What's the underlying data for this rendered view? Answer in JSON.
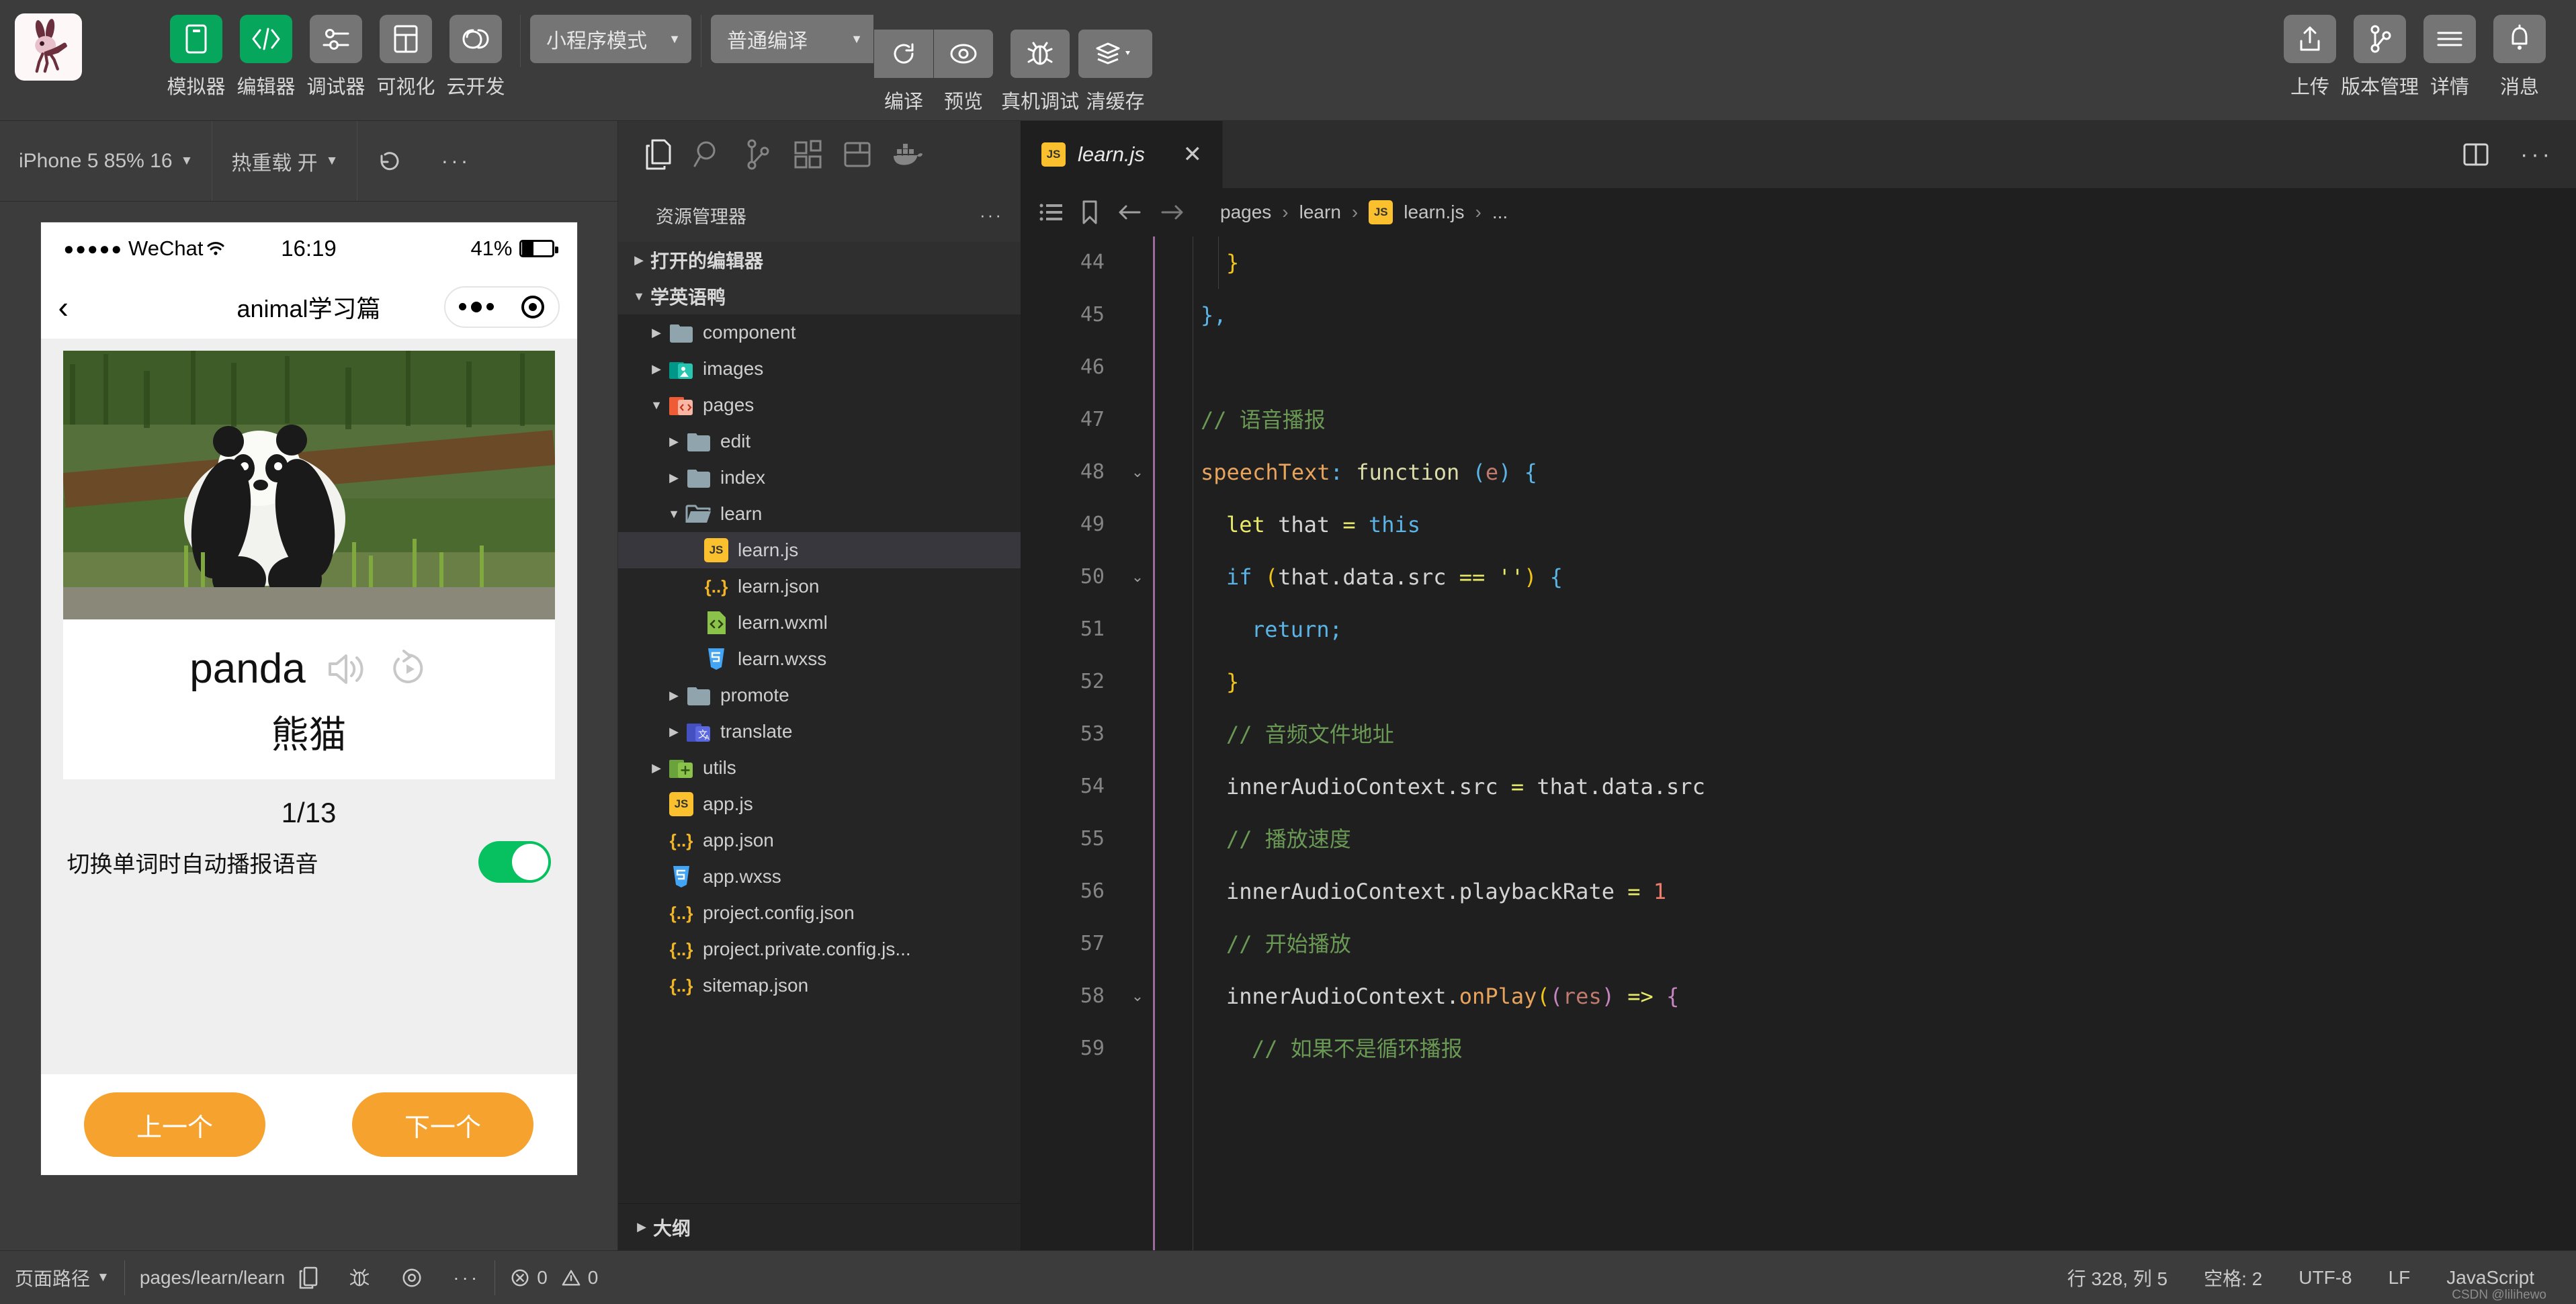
{
  "toolbar": {
    "items": [
      {
        "label": "模拟器",
        "icon": "simulator-icon",
        "active": true
      },
      {
        "label": "编辑器",
        "icon": "code-icon",
        "active": true
      },
      {
        "label": "调试器",
        "icon": "debugger-icon",
        "active": false
      },
      {
        "label": "可视化",
        "icon": "visualize-icon",
        "active": false
      },
      {
        "label": "云开发",
        "icon": "cloud-icon",
        "active": false
      }
    ],
    "mode_select": "小程序模式",
    "compile_select": "普通编译",
    "compile_label": "编译",
    "preview_label": "预览",
    "realdevice_label": "真机调试",
    "clearcache_label": "清缓存",
    "upload_label": "上传",
    "version_label": "版本管理",
    "detail_label": "详情",
    "message_label": "消息"
  },
  "simulator": {
    "device": "iPhone 5 85% 16",
    "hotreload": "热重载 开",
    "phone": {
      "carrier": "WeChat",
      "time": "16:19",
      "battery": "41%",
      "nav_title": "animal学习篇",
      "word": "panda",
      "translation": "熊猫",
      "counter": "1/13",
      "autoplay_label": "切换单词时自动播报语音",
      "prev_button": "上一个",
      "next_button": "下一个"
    }
  },
  "explorer": {
    "title": "资源管理器",
    "more": "···",
    "outline": "大纲",
    "tree": [
      {
        "label": "打开的编辑器",
        "type": "section",
        "indent": 0,
        "arrow": "right"
      },
      {
        "label": "学英语鸭",
        "type": "section",
        "indent": 0,
        "arrow": "down"
      },
      {
        "label": "component",
        "type": "folder",
        "indent": 1,
        "arrow": "right",
        "icon": "folder-plain"
      },
      {
        "label": "images",
        "type": "folder",
        "indent": 1,
        "arrow": "right",
        "icon": "folder-images"
      },
      {
        "label": "pages",
        "type": "folder",
        "indent": 1,
        "arrow": "down",
        "icon": "folder-pages"
      },
      {
        "label": "edit",
        "type": "folder",
        "indent": 2,
        "arrow": "right",
        "icon": "folder-plain"
      },
      {
        "label": "index",
        "type": "folder",
        "indent": 2,
        "arrow": "right",
        "icon": "folder-plain"
      },
      {
        "label": "learn",
        "type": "folder",
        "indent": 2,
        "arrow": "down",
        "icon": "folder-open"
      },
      {
        "label": "learn.js",
        "type": "file",
        "indent": 3,
        "arrow": "none",
        "icon": "js",
        "selected": true
      },
      {
        "label": "learn.json",
        "type": "file",
        "indent": 3,
        "arrow": "none",
        "icon": "json"
      },
      {
        "label": "learn.wxml",
        "type": "file",
        "indent": 3,
        "arrow": "none",
        "icon": "wxml"
      },
      {
        "label": "learn.wxss",
        "type": "file",
        "indent": 3,
        "arrow": "none",
        "icon": "wxss"
      },
      {
        "label": "promote",
        "type": "folder",
        "indent": 2,
        "arrow": "right",
        "icon": "folder-plain"
      },
      {
        "label": "translate",
        "type": "folder",
        "indent": 2,
        "arrow": "right",
        "icon": "folder-translate"
      },
      {
        "label": "utils",
        "type": "folder",
        "indent": 1,
        "arrow": "right",
        "icon": "folder-utils"
      },
      {
        "label": "app.js",
        "type": "file",
        "indent": 1,
        "arrow": "none",
        "icon": "js"
      },
      {
        "label": "app.json",
        "type": "file",
        "indent": 1,
        "arrow": "none",
        "icon": "json"
      },
      {
        "label": "app.wxss",
        "type": "file",
        "indent": 1,
        "arrow": "none",
        "icon": "wxss"
      },
      {
        "label": "project.config.json",
        "type": "file",
        "indent": 1,
        "arrow": "none",
        "icon": "json"
      },
      {
        "label": "project.private.config.js...",
        "type": "file",
        "indent": 1,
        "arrow": "none",
        "icon": "json"
      },
      {
        "label": "sitemap.json",
        "type": "file",
        "indent": 1,
        "arrow": "none",
        "icon": "json"
      }
    ]
  },
  "editor": {
    "tab_name": "learn.js",
    "tab_close": "✕",
    "breadcrumb": [
      "pages",
      "learn",
      "learn.js",
      "..."
    ],
    "lines": [
      {
        "no": "44",
        "fold": "",
        "indent": 2,
        "tokens": [
          {
            "t": "}",
            "c": "tok-par"
          }
        ]
      },
      {
        "no": "45",
        "fold": "",
        "indent": 1,
        "tokens": [
          {
            "t": "},",
            "c": "tok-brc"
          }
        ]
      },
      {
        "no": "46",
        "fold": "",
        "indent": 0,
        "tokens": []
      },
      {
        "no": "47",
        "fold": "",
        "indent": 1,
        "tokens": [
          {
            "t": "// 语音播报",
            "c": "tok-cmt"
          }
        ]
      },
      {
        "no": "48",
        "fold": "v",
        "indent": 1,
        "tokens": [
          {
            "t": "speechText",
            "c": "tok-prop"
          },
          {
            "t": ": ",
            "c": "tok-brc"
          },
          {
            "t": "function ",
            "c": "tok-fn"
          },
          {
            "t": "(",
            "c": "tok-brc"
          },
          {
            "t": "e",
            "c": "tok-arg"
          },
          {
            "t": ")",
            "c": "tok-brc"
          },
          {
            "t": " {",
            "c": "tok-brc"
          }
        ]
      },
      {
        "no": "49",
        "fold": "",
        "indent": 2,
        "tokens": [
          {
            "t": "let ",
            "c": "tok-kw2"
          },
          {
            "t": "that ",
            "c": "tok-var"
          },
          {
            "t": "= ",
            "c": "tok-op"
          },
          {
            "t": "this",
            "c": "tok-brc"
          }
        ]
      },
      {
        "no": "50",
        "fold": "v",
        "indent": 2,
        "tokens": [
          {
            "t": "if ",
            "c": "tok-brc"
          },
          {
            "t": "(",
            "c": "tok-par"
          },
          {
            "t": "that.data.src ",
            "c": "tok-var"
          },
          {
            "t": "== ",
            "c": "tok-op"
          },
          {
            "t": "''",
            "c": "tok-op"
          },
          {
            "t": ")",
            "c": "tok-par"
          },
          {
            "t": " {",
            "c": "tok-brc"
          }
        ]
      },
      {
        "no": "51",
        "fold": "",
        "indent": 3,
        "tokens": [
          {
            "t": "return;",
            "c": "tok-brc"
          }
        ]
      },
      {
        "no": "52",
        "fold": "",
        "indent": 2,
        "tokens": [
          {
            "t": "}",
            "c": "tok-par"
          }
        ]
      },
      {
        "no": "53",
        "fold": "",
        "indent": 2,
        "tokens": [
          {
            "t": "// 音频文件地址",
            "c": "tok-cmt"
          }
        ]
      },
      {
        "no": "54",
        "fold": "",
        "indent": 2,
        "tokens": [
          {
            "t": "innerAudioContext.src ",
            "c": "tok-var"
          },
          {
            "t": "= ",
            "c": "tok-op"
          },
          {
            "t": "that.data.src",
            "c": "tok-var"
          }
        ]
      },
      {
        "no": "55",
        "fold": "",
        "indent": 2,
        "tokens": [
          {
            "t": "// 播放速度",
            "c": "tok-cmt"
          }
        ]
      },
      {
        "no": "56",
        "fold": "",
        "indent": 2,
        "tokens": [
          {
            "t": "innerAudioContext.playbackRate ",
            "c": "tok-var"
          },
          {
            "t": "= ",
            "c": "tok-op"
          },
          {
            "t": "1",
            "c": "tok-num"
          }
        ]
      },
      {
        "no": "57",
        "fold": "",
        "indent": 2,
        "tokens": [
          {
            "t": "// 开始播放",
            "c": "tok-cmt"
          }
        ]
      },
      {
        "no": "58",
        "fold": "v",
        "indent": 2,
        "tokens": [
          {
            "t": "innerAudioContext.",
            "c": "tok-var"
          },
          {
            "t": "onPlay",
            "c": "tok-prop"
          },
          {
            "t": "(",
            "c": "tok-par"
          },
          {
            "t": "(",
            "c": "tok-par2"
          },
          {
            "t": "res",
            "c": "tok-arg"
          },
          {
            "t": ")",
            "c": "tok-par2"
          },
          {
            "t": " => ",
            "c": "tok-op"
          },
          {
            "t": "{",
            "c": "tok-par2"
          }
        ]
      },
      {
        "no": "59",
        "fold": "",
        "indent": 3,
        "tokens": [
          {
            "t": "// 如果不是循环播报",
            "c": "tok-cmt"
          }
        ]
      }
    ]
  },
  "statusbar": {
    "page_path_label": "页面路径",
    "page_path_value": "pages/learn/learn",
    "errors": "0",
    "warnings": "0",
    "cursor": "行 328, 列 5",
    "spaces": "空格: 2",
    "encoding": "UTF-8",
    "eol": "LF",
    "language": "JavaScript",
    "watermark": "CSDN @lilihewo"
  },
  "colors": {
    "accent_green": "#07a65d",
    "toolbar_bg": "#3c3c3c",
    "editor_bg": "#1f1f1f",
    "explorer_bg": "#252526",
    "orange_button": "#f5a22e",
    "switch_on": "#07c160"
  }
}
